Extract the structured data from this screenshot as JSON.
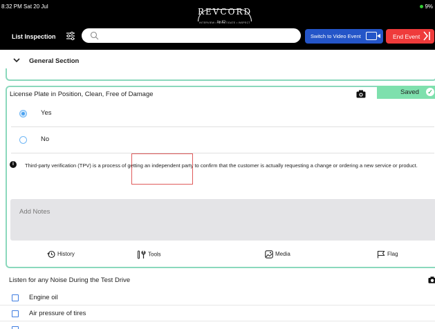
{
  "status": {
    "time": "8:32 PM",
    "date": "Sat 20 Jul",
    "battery": "9%"
  },
  "brand": {
    "name": "REVCORD",
    "tagline": "INTERVIEW • INVESTIGATE • INSPECT",
    "script": "by IQ"
  },
  "nav": {
    "title": "List Inspection",
    "search_placeholder": "",
    "video_button": "Switch to Video Event",
    "end_button": "End Event"
  },
  "section": {
    "title": "General Section"
  },
  "question": {
    "title": "License Plate in Position, Clean, Free of Damage",
    "saved_label": "Saved",
    "options": [
      {
        "label": "Yes",
        "selected": true
      },
      {
        "label": "No",
        "selected": false
      }
    ],
    "info": "Third-party verification (TPV) is a process of getting an independent party to confirm that the customer is actually requesting a change or ordering a new service or product.",
    "notes_placeholder": "Add Notes",
    "tools": [
      {
        "label": "History",
        "icon": "history-icon"
      },
      {
        "label": "Tools",
        "icon": "tools-icon"
      },
      {
        "label": "Media",
        "icon": "media-icon"
      },
      {
        "label": "Flag",
        "icon": "flag-icon"
      }
    ]
  },
  "question2": {
    "title": "Listen for any Noise During the Test Drive",
    "items": [
      {
        "label": "Engine oil"
      },
      {
        "label": "Air pressure of tires"
      },
      {
        "label": ""
      }
    ]
  },
  "colors": {
    "accent_blue": "#2455c8",
    "end_red": "#ef3b3b",
    "saved_green": "#7ee0ad",
    "card_border": "#8ad8bc",
    "highlight": "#e05a5a"
  }
}
